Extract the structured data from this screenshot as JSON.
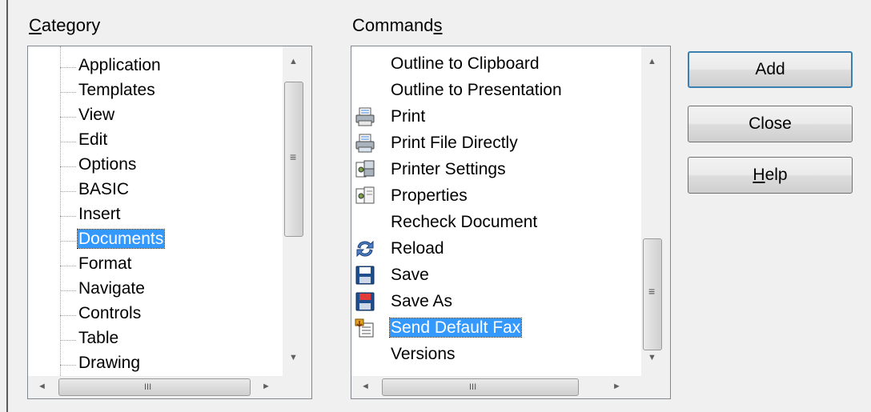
{
  "category": {
    "label_first": "C",
    "label_rest": "ategory",
    "items": [
      "Application",
      "Templates",
      "View",
      "Edit",
      "Options",
      "BASIC",
      "Insert",
      "Documents",
      "Format",
      "Navigate",
      "Controls",
      "Table",
      "Drawing"
    ],
    "selected": "Documents"
  },
  "commands": {
    "label_main": "Command",
    "label_ul": "s",
    "items": [
      {
        "label": "Outline to Clipboard",
        "icon": ""
      },
      {
        "label": "Outline to Presentation",
        "icon": ""
      },
      {
        "label": "Print",
        "icon": "printer-icon"
      },
      {
        "label": "Print File Directly",
        "icon": "printer-direct-icon"
      },
      {
        "label": "Printer Settings",
        "icon": "printer-settings-icon"
      },
      {
        "label": "Properties",
        "icon": "properties-icon"
      },
      {
        "label": "Recheck Document",
        "icon": ""
      },
      {
        "label": "Reload",
        "icon": "reload-icon"
      },
      {
        "label": "Save",
        "icon": "save-icon"
      },
      {
        "label": "Save As",
        "icon": "save-as-icon"
      },
      {
        "label": "Send Default Fax",
        "icon": "fax-icon"
      },
      {
        "label": "Versions",
        "icon": ""
      }
    ],
    "selected": "Send Default Fax"
  },
  "buttons": {
    "add": "Add",
    "close": "Close",
    "help_ul": "H",
    "help_rest": "elp"
  },
  "scrollbar_glyphs": {
    "up": "▲",
    "down": "▼",
    "left": "◄",
    "right": "►",
    "grip_v": "≡",
    "grip_h": "III"
  }
}
